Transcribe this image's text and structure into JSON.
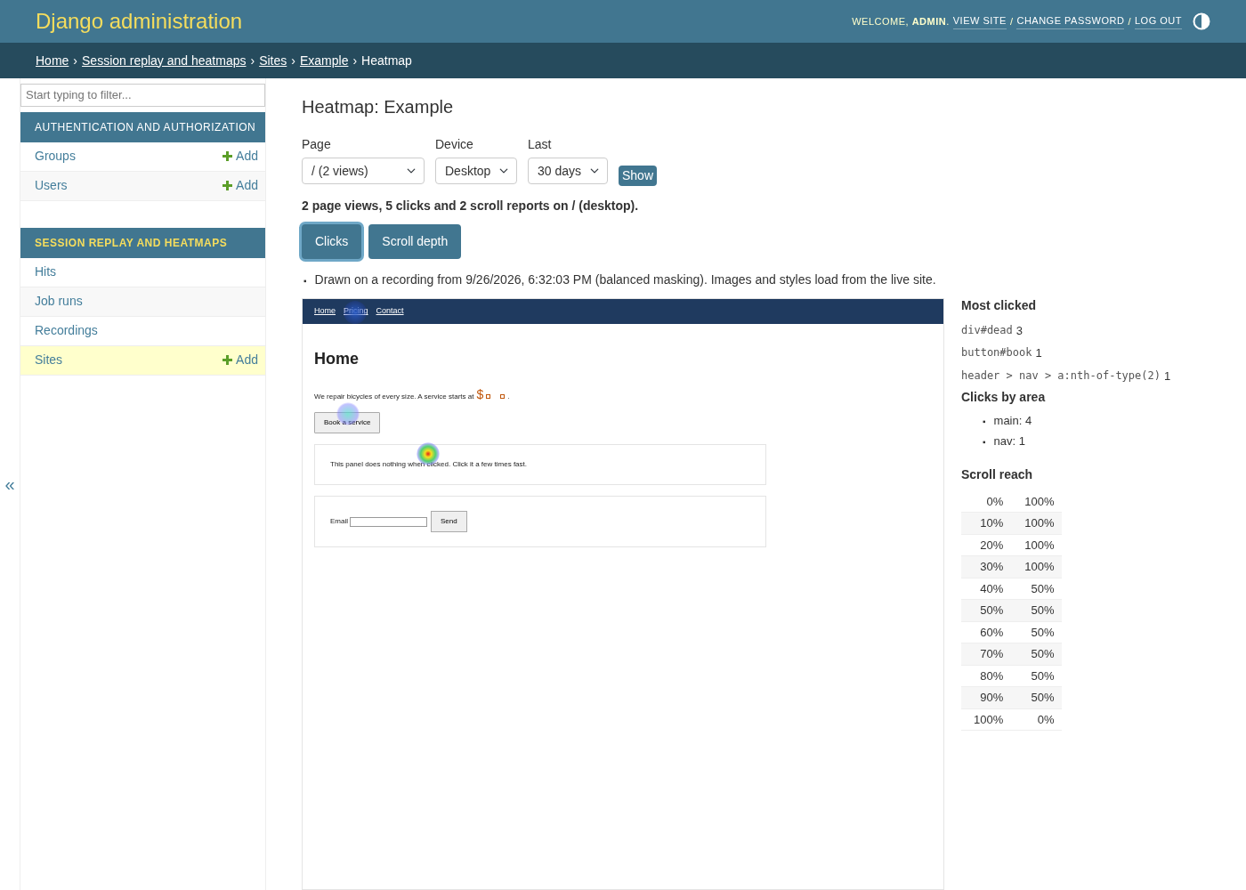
{
  "header": {
    "title": "Django administration",
    "welcome": "WELCOME, **ADMIN**.",
    "links": [
      "VIEW SITE",
      "CHANGE PASSWORD",
      "LOG OUT"
    ],
    "separator": "/"
  },
  "breadcrumbs": {
    "items": [
      "Home",
      "Session replay and heatmaps",
      "Sites",
      "Example",
      "Heatmap"
    ],
    "separator": "›"
  },
  "sidebar": {
    "filter_placeholder": "Start typing to filter...",
    "collapse": "«",
    "modules": [
      {
        "title": "AUTHENTICATION AND AUTHORIZATION",
        "selected": false,
        "models": [
          {
            "name": "Groups",
            "add": "Add",
            "selected": false
          },
          {
            "name": "Users",
            "add": "Add",
            "selected": false
          }
        ]
      },
      {
        "title": "SESSION REPLAY AND HEATMAPS",
        "selected": true,
        "models": [
          {
            "name": "Hits",
            "selected": false
          },
          {
            "name": "Job runs",
            "selected": false
          },
          {
            "name": "Recordings",
            "selected": false
          },
          {
            "name": "Sites",
            "add": "Add",
            "selected": true
          }
        ]
      }
    ]
  },
  "content": {
    "title": "Heatmap: Example",
    "filters": [
      {
        "label": "Page",
        "value": "/ (2 views)"
      },
      {
        "label": "Device",
        "value": "Desktop"
      },
      {
        "label": "Last",
        "value": "30 days"
      }
    ],
    "show_button": "Show",
    "summary": "2 page views, 5 clicks and 2 scroll reports on / (desktop).",
    "view_tabs": [
      {
        "label": "Clicks",
        "selected": true
      },
      {
        "label": "Scroll depth",
        "selected": false
      }
    ],
    "bullet": "▪",
    "notes": [
      "Drawn on a recording from 9/26/2026, 6:32:03 PM (balanced masking). Images and styles load from the live site."
    ],
    "preview": {
      "nav": [
        "Home",
        "Pricing",
        "Contact"
      ],
      "heading": "Home",
      "intro": "We repair bicycles of every size. A service starts at",
      "price": "$",
      "intro_end": ".",
      "book_button": "Book a service",
      "panel_text": "This panel does nothing when clicked. Click it a few times fast.",
      "email_label": "Email",
      "send_button": "Send"
    },
    "most_clicked": {
      "title": "Most clicked",
      "items": [
        {
          "selector": "div#dead",
          "count": "3"
        },
        {
          "selector": "button#book",
          "count": "1"
        },
        {
          "selector": "header > nav > a:nth-of-type(2)",
          "count": "1"
        }
      ]
    },
    "clicks_by_area": {
      "title": "Clicks by area",
      "items": [
        "main: 4",
        "nav: 1"
      ]
    },
    "scroll_reach": {
      "title": "Scroll reach",
      "rows": [
        {
          "depth": "0%",
          "reach": "100%"
        },
        {
          "depth": "10%",
          "reach": "100%"
        },
        {
          "depth": "20%",
          "reach": "100%"
        },
        {
          "depth": "30%",
          "reach": "100%"
        },
        {
          "depth": "40%",
          "reach": "50%"
        },
        {
          "depth": "50%",
          "reach": "50%"
        },
        {
          "depth": "60%",
          "reach": "50%"
        },
        {
          "depth": "70%",
          "reach": "50%"
        },
        {
          "depth": "80%",
          "reach": "50%"
        },
        {
          "depth": "90%",
          "reach": "50%"
        },
        {
          "depth": "100%",
          "reach": "0%"
        }
      ]
    }
  }
}
